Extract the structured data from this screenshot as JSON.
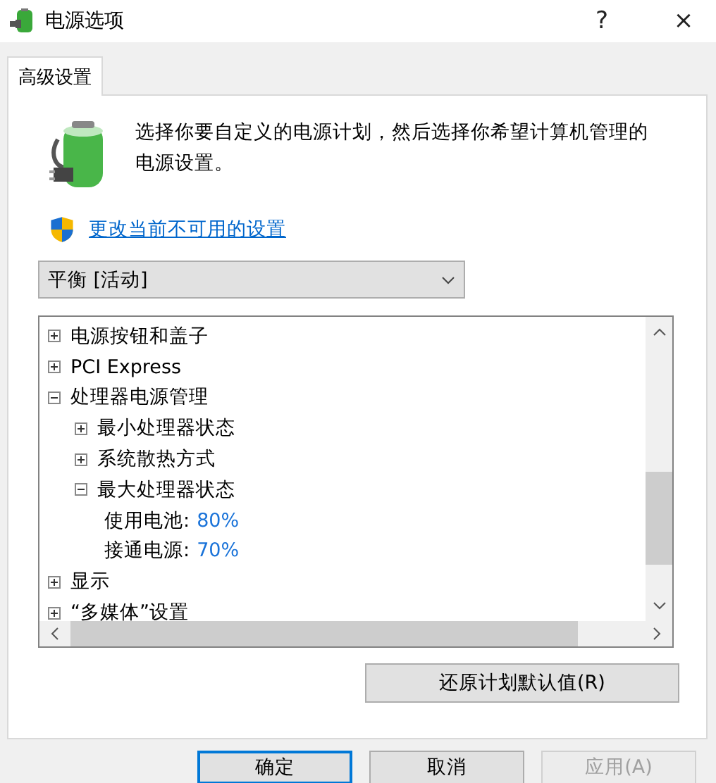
{
  "window": {
    "title": "电源选项",
    "help_button": "?",
    "close_button": "×"
  },
  "tabs": [
    {
      "label": "高级设置",
      "selected": true
    }
  ],
  "description": "选择你要自定义的电源计划，然后选择你希望计算机管理的电源设置。",
  "link": "更改当前不可用的设置",
  "plan_dropdown": {
    "value": "平衡 [活动]"
  },
  "tree": {
    "items": [
      {
        "kind": "group",
        "label": "电源按钮和盖子",
        "expanded": false
      },
      {
        "kind": "group",
        "label": "PCI Express",
        "expanded": false
      },
      {
        "kind": "group",
        "label": "处理器电源管理",
        "expanded": true,
        "children": [
          {
            "kind": "group",
            "label": "最小处理器状态",
            "expanded": false
          },
          {
            "kind": "group",
            "label": "系统散热方式",
            "expanded": false
          },
          {
            "kind": "group",
            "label": "最大处理器状态",
            "expanded": true,
            "children": [
              {
                "kind": "setting",
                "label": "使用电池:",
                "value": "80%"
              },
              {
                "kind": "setting",
                "label": "接通电源:",
                "value": "70%"
              }
            ]
          }
        ]
      },
      {
        "kind": "group",
        "label": "显示",
        "expanded": false
      },
      {
        "kind": "group",
        "label": "“多媒体”设置",
        "expanded": false
      }
    ]
  },
  "restore_button": "还原计划默认值(R)",
  "dialog_buttons": [
    {
      "label": "确定",
      "default": true,
      "disabled": false
    },
    {
      "label": "取消",
      "default": false,
      "disabled": false
    },
    {
      "label": "应用(A)",
      "default": false,
      "disabled": true
    }
  ]
}
